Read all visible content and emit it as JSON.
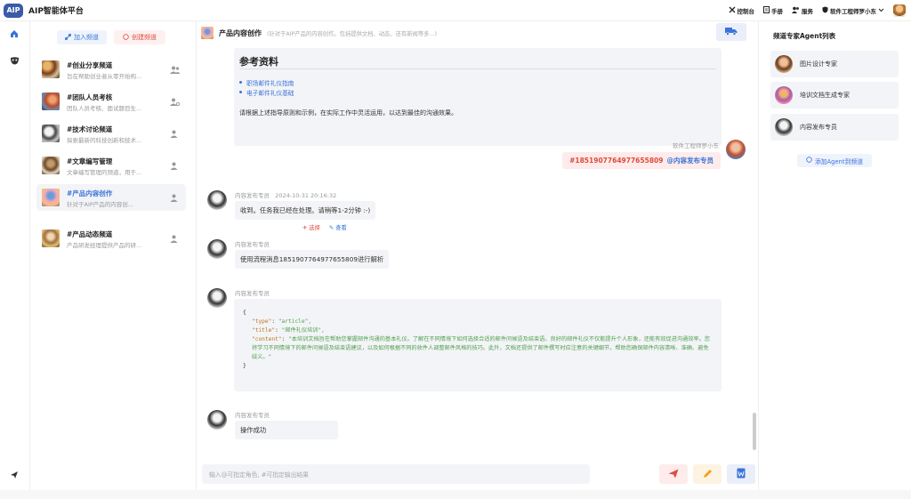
{
  "app": {
    "logo": "AIP",
    "title": "AIP智能体平台"
  },
  "topnav": {
    "console": "控制台",
    "manual": "手册",
    "service": "服务",
    "user": "软件工程师罗小东"
  },
  "channels_panel": {
    "join_label": "加入频道",
    "create_label": "创建频道",
    "items": [
      {
        "name": "#创业分享频道",
        "desc": "旨在帮助创业者从零开始构...",
        "icon": "group-icon"
      },
      {
        "name": "#团队人员考核",
        "desc": "团队人员考核、面试题目生...",
        "icon": "user-gear-icon"
      },
      {
        "name": "#技术讨论频道",
        "desc": "探索最新的科技创新和技术...",
        "icon": "user-icon"
      },
      {
        "name": "#文章编写管理",
        "desc": "文章编写管理的频道，用于...",
        "icon": "user-icon"
      },
      {
        "name": "#产品内容创作",
        "desc": "针对于AIP产品的内容创...",
        "icon": "user-icon",
        "active": true
      },
      {
        "name": "#产品动态频道",
        "desc": "产品研发经理提供产品的研...",
        "icon": "user-icon"
      }
    ]
  },
  "chat": {
    "title": "产品内容创作",
    "description": "(针对于AIP产品的内容创作。包括提供文档、动态、还有新闻等多...)",
    "reference": {
      "heading": "参考资料",
      "links": [
        "职场邮件礼仪指南",
        "电子邮件礼仪基础"
      ],
      "note": "请根据上述指导原则和示例，在实际工作中灵活运用，以达到最佳的沟通效果。"
    },
    "sent": {
      "sender": "软件工程师罗小东",
      "id": "#1851907764977655809",
      "mention": "@内容发布专员"
    },
    "messages": [
      {
        "sender": "内容发布专员",
        "time": "2024-10-31 20:16:32",
        "text": "收到。任务我已经在处理。请稍等1-2分钟 :-)",
        "action_select": "选择",
        "action_view": "查看"
      },
      {
        "sender": "内容发布专员",
        "text": "使用流程消息1851907764977655809进行解析"
      },
      {
        "sender": "内容发布专员"
      },
      {
        "sender": "内容发布专员",
        "text": "操作成功"
      }
    ],
    "code": {
      "open": "{",
      "close": "}",
      "type_key": "\"type\"",
      "type_val": "\"article\",",
      "title_key": "\"title\"",
      "title_val": "\"邮件礼仪培训\",",
      "content_key": "\"content\"",
      "content_val": "\"本培训文档旨在帮助您掌握邮件沟通的基本礼仪。了解在不同情境下如何选择合适的邮件问候语及结束语。良好的邮件礼仪不仅能提升个人形象，还能有效促进沟通效率。您将学习不同情境下的邮件问候语及结束语建议，以及如何根据不同的收件人调整邮件风格的技巧。此外，文档还提供了邮件撰写时应注意的关键细节，帮助您确保邮件内容清晰、准确、避免歧义。\""
    },
    "input_placeholder": "输入@可指定角色, #可指定输出结果"
  },
  "agents_panel": {
    "title": "频道专家Agent列表",
    "agents": [
      "图片设计专家",
      "培训文档生成专家",
      "内容发布专员"
    ],
    "add_label": "添加Agent到频道"
  },
  "colors": {
    "accent": "#3a74d8",
    "danger": "#e0493f",
    "logo": "#3b5ba9",
    "bubble": "#f3f4f7"
  }
}
